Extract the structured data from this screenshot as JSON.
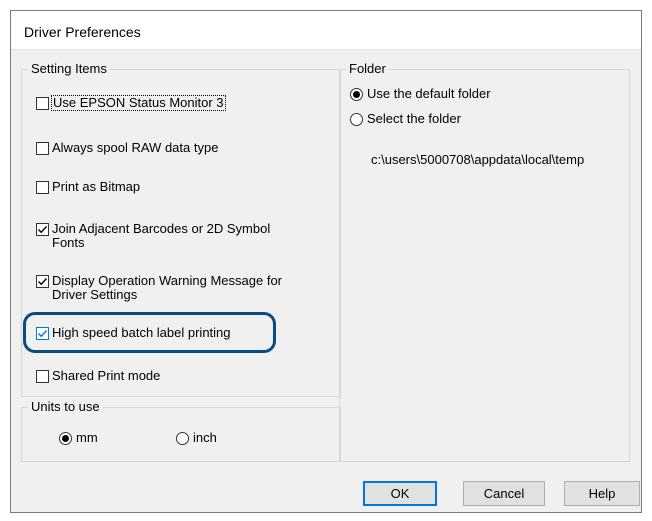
{
  "dialog": {
    "title": "Driver Preferences"
  },
  "setting_items": {
    "legend": "Setting Items",
    "items": [
      {
        "label": "Use EPSON Status Monitor 3",
        "checked": false
      },
      {
        "label": "Always spool RAW data type",
        "checked": false
      },
      {
        "label": "Print as Bitmap",
        "checked": false
      },
      {
        "label": "Join Adjacent Barcodes or 2D Symbol",
        "label2": "Fonts",
        "checked": true
      },
      {
        "label": "Display Operation Warning Message for",
        "label2": "Driver Settings",
        "checked": true
      },
      {
        "label": "High speed batch label printing",
        "checked": true
      },
      {
        "label": "Shared Print mode",
        "checked": false
      }
    ]
  },
  "units": {
    "legend": "Units to use",
    "options": [
      {
        "label": "mm",
        "selected": true
      },
      {
        "label": "inch",
        "selected": false
      }
    ]
  },
  "folder": {
    "legend": "Folder",
    "options": [
      {
        "label": "Use the default folder",
        "selected": true
      },
      {
        "label": "Select the folder",
        "selected": false
      }
    ],
    "path": "c:\\users\\5000708\\appdata\\local\\temp"
  },
  "buttons": {
    "ok": "OK",
    "cancel": "Cancel",
    "help": "Help"
  },
  "colors": {
    "highlight_border": "#0a4a82",
    "check_color": "#0078d7",
    "default_button_border": "#0078d7"
  }
}
